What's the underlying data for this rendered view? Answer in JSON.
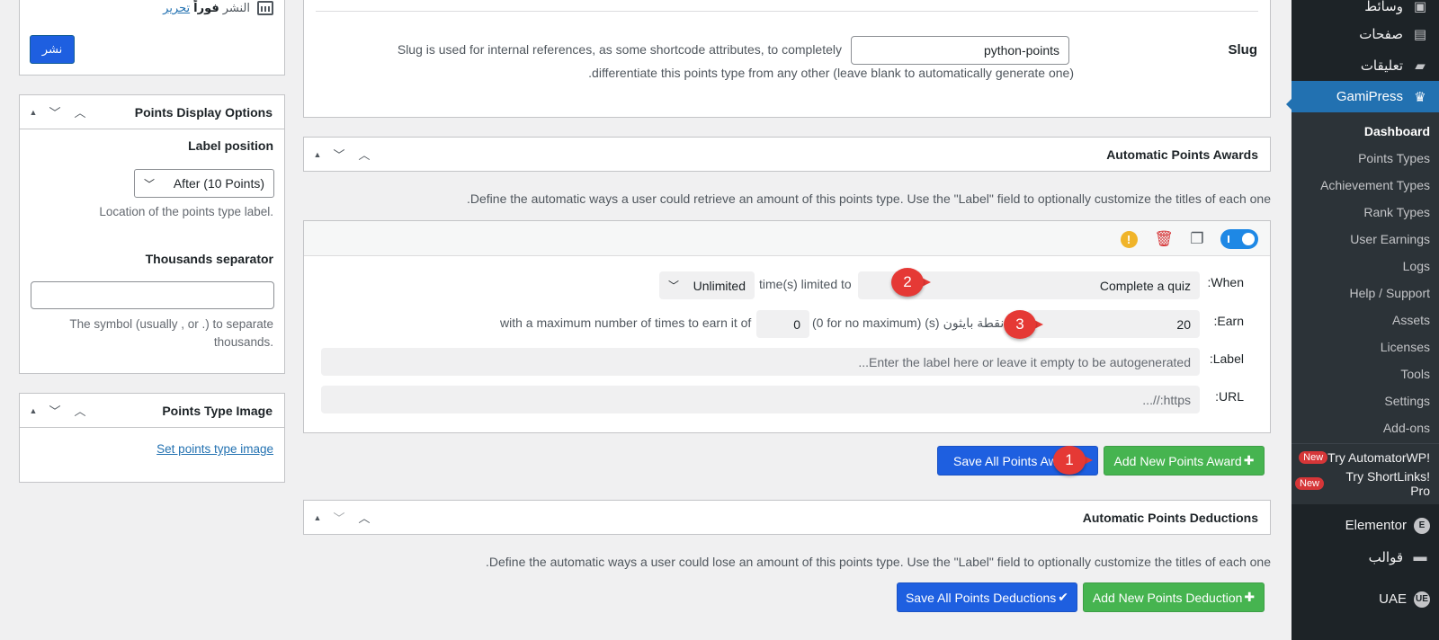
{
  "sidebar": {
    "media": "وسائط",
    "pages": "صفحات",
    "comments": "تعليقات",
    "gamipress": "GamiPress",
    "submenu": [
      "Dashboard",
      "Points Types",
      "Achievement Types",
      "Rank Types",
      "User Earnings",
      "Logs",
      "Help / Support",
      "Assets",
      "Licenses",
      "Tools",
      "Settings",
      "Add-ons"
    ],
    "promo1": "!Try AutomatorWP",
    "promo2": "!Try ShortLinks Pro",
    "new_badge": "New",
    "elementor": "Elementor",
    "templates": "قوالب",
    "uae": "UAE"
  },
  "publish": {
    "label": "النشر",
    "value": "فوراً",
    "edit": "تحرير",
    "button": "نشر"
  },
  "points_display": {
    "title": "Points Display Options",
    "label_position": "Label position",
    "label_position_value": "After (10 Points)",
    "label_position_help": ".Location of the points type label",
    "thousands": "Thousands separator",
    "thousands_value": "",
    "thousands_help_1": "The symbol (usually , or .) to separate",
    "thousands_help_2": ".thousands"
  },
  "points_image": {
    "title": "Points Type Image",
    "link": "Set points type image"
  },
  "slug": {
    "label": "Slug",
    "value": "python-points",
    "help_1": "Slug is used for internal references, as some shortcode attributes, to completely",
    "help_2": ".differentiate this points type from any other (leave blank to automatically generate one)"
  },
  "awards": {
    "title": "Automatic Points Awards",
    "description": ".Define the automatic ways a user could retrieve an amount of this points type. Use the \"Label\" field to optionally customize the titles of each one",
    "when_label": ":When",
    "when_value": "Complete a quiz",
    "limited_text": "time(s) limited to",
    "limit_value": "Unlimited",
    "earn_label": ":Earn",
    "earn_value": "20",
    "earn_unit": "نقطة بايثون",
    "earn_suffix": "(0 for no maximum) (s)",
    "max_value": "0",
    "max_text": "with a maximum number of times to earn it of",
    "label_label": ":Label",
    "label_placeholder": "...Enter the label here or leave it empty to be autogenerated",
    "url_label": ":URL",
    "url_placeholder": "...//:https",
    "save_button": "Save All Points Awards",
    "add_button": "Add New Points Award"
  },
  "deductions": {
    "title": "Automatic Points Deductions",
    "description": ".Define the automatic ways a user could lose an amount of this points type. Use the \"Label\" field to optionally customize the titles of each one",
    "save_button": "Save All Points Deductions",
    "add_button": "Add New Points Deduction"
  },
  "markers": [
    "1",
    "2",
    "3"
  ],
  "colors": {
    "wp_dark": "#1d2327",
    "wp_blue": "#2271b1",
    "button_blue": "#1e5fe0",
    "button_green": "#46b450",
    "marker_red": "#e53935"
  }
}
